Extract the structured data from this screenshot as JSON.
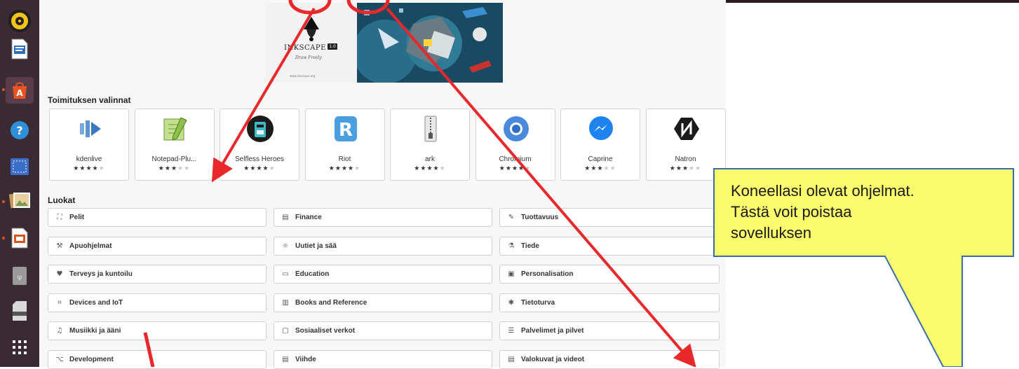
{
  "dock": {
    "items": [
      {
        "name": "rhythmbox-icon",
        "color": "#f5c21b"
      },
      {
        "name": "libreoffice-writer-icon",
        "color": "#2a6fb8"
      },
      {
        "name": "ubuntu-software-icon",
        "color": "#e95420"
      },
      {
        "name": "help-icon",
        "color": "#2f8fd8"
      },
      {
        "name": "screenshot-icon",
        "color": "#3a6ec8"
      },
      {
        "name": "image-viewer-icon",
        "color": "#c89a5a"
      },
      {
        "name": "libreoffice-impress-icon",
        "color": "#d9541e"
      },
      {
        "name": "usb-drive-icon",
        "color": "#9a9a9a"
      },
      {
        "name": "sd-card-icon",
        "color": "#bdbdbd"
      },
      {
        "name": "show-applications-icon",
        "color": "#ffffff"
      }
    ]
  },
  "banner": {
    "title": "INKSCAPE",
    "version": "1.0",
    "subtitle": "Draw Freely",
    "url": "www.inkscape.org"
  },
  "editors_picks": {
    "title": "Toimituksen valinnat",
    "apps": [
      {
        "name": "kdenlive",
        "stars": 4,
        "icon": "kdenlive-icon"
      },
      {
        "name": "Notepad-Plu...",
        "stars": 3,
        "icon": "notepad-plus-plus-icon"
      },
      {
        "name": "Selfless Heroes",
        "stars": 4,
        "icon": "selfless-heroes-icon"
      },
      {
        "name": "Riot",
        "stars": 4,
        "icon": "riot-icon"
      },
      {
        "name": "ark",
        "stars": 4,
        "icon": "ark-icon"
      },
      {
        "name": "Chromium",
        "stars": 4,
        "icon": "chromium-icon"
      },
      {
        "name": "Caprine",
        "stars": 3,
        "icon": "caprine-icon"
      },
      {
        "name": "Natron",
        "stars": 3,
        "icon": "natron-icon"
      }
    ]
  },
  "categories": {
    "title": "Luokat",
    "items": [
      {
        "label": "Pelit",
        "icon": "game-icon",
        "glyph": "⛶"
      },
      {
        "label": "Finance",
        "icon": "finance-icon",
        "glyph": "▤"
      },
      {
        "label": "Tuottavuus",
        "icon": "productivity-icon",
        "glyph": "✎"
      },
      {
        "label": "Apuohjelmat",
        "icon": "utilities-icon",
        "glyph": "⚒"
      },
      {
        "label": "Uutiet ja sää",
        "icon": "news-weather-icon",
        "glyph": "☼"
      },
      {
        "label": "Tiede",
        "icon": "science-icon",
        "glyph": "⚗"
      },
      {
        "label": "Terveys ja kuntoilu",
        "icon": "health-icon",
        "glyph": "♥"
      },
      {
        "label": "Education",
        "icon": "education-icon",
        "glyph": "▭"
      },
      {
        "label": "Personalisation",
        "icon": "personalisation-icon",
        "glyph": "▣"
      },
      {
        "label": "Devices and IoT",
        "icon": "devices-icon",
        "glyph": "⌗"
      },
      {
        "label": "Books and Reference",
        "icon": "books-icon",
        "glyph": "▥"
      },
      {
        "label": "Tietoturva",
        "icon": "security-icon",
        "glyph": "✱"
      },
      {
        "label": "Musiikki ja ääni",
        "icon": "music-icon",
        "glyph": "♫"
      },
      {
        "label": "Sosiaaliset verkot",
        "icon": "social-icon",
        "glyph": "▢"
      },
      {
        "label": "Palvelimet ja pilvet",
        "icon": "server-icon",
        "glyph": "☰"
      },
      {
        "label": "Development",
        "icon": "development-icon",
        "glyph": "⌥"
      },
      {
        "label": "Viihde",
        "icon": "entertainment-icon",
        "glyph": "▤"
      },
      {
        "label": "Valokuvat ja videot",
        "icon": "photo-video-icon",
        "glyph": "▤"
      }
    ]
  },
  "callout": {
    "lines": [
      "Koneellasi olevat ohjelmat.",
      "Tästä voit poistaa",
      "sovelluksen"
    ],
    "fill": "#fbfb6e",
    "border": "#3b6ea8"
  },
  "annotation_color": "#e8282b"
}
